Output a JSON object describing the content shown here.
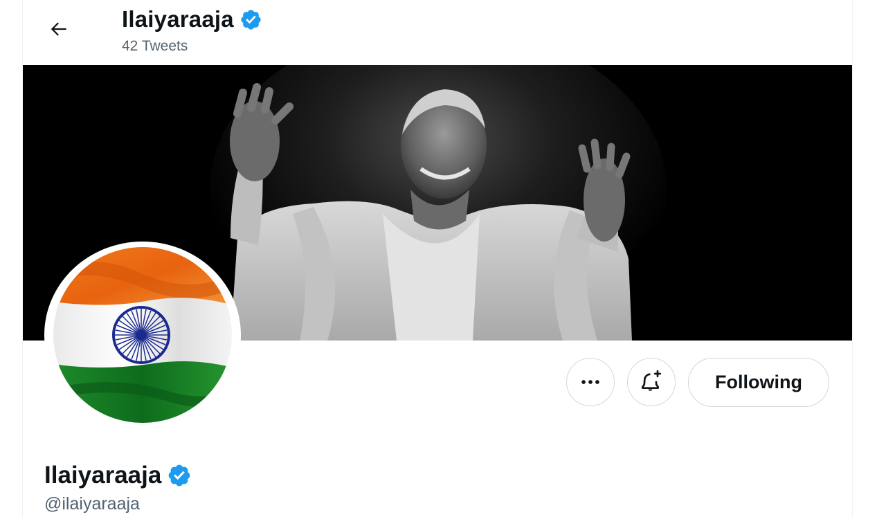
{
  "header": {
    "back_icon": "arrow-left-icon",
    "name": "Ilaiyaraaja",
    "tweet_count": "42 Tweets"
  },
  "banner": {
    "description": "black-and-white photo banner"
  },
  "avatar": {
    "description": "waving Indian flag"
  },
  "actions": {
    "more_icon": "more-horizontal-icon",
    "notify_icon": "bell-plus-icon",
    "following_label": "Following"
  },
  "profile": {
    "name": "Ilaiyaraaja",
    "handle": "@ilaiyaraaja",
    "verified_icon": "verified-badge-icon"
  },
  "colors": {
    "verified_blue": "#1d9bf0",
    "secondary_text": "#536471",
    "primary_text": "#0f1419",
    "border": "#cfd9de"
  }
}
